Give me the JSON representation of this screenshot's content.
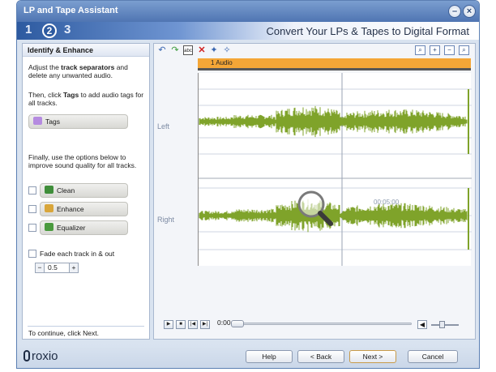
{
  "window": {
    "title": "LP and Tape Assistant"
  },
  "steps": {
    "items": [
      "1",
      "2",
      "3"
    ],
    "active": "2",
    "heading": "Convert Your LPs & Tapes to Digital Format"
  },
  "sidebar": {
    "title": "Identify & Enhance",
    "intro_prefix": "Adjust the ",
    "intro_bold": "track separators",
    "intro_suffix": " and delete any unwanted audio.",
    "tags_prefix": "Then, click ",
    "tags_bold": "Tags",
    "tags_suffix": " to add audio tags for all tracks.",
    "tags_button": "Tags",
    "options_text": "Finally, use the options below to improve sound quality for all tracks.",
    "clean_label": "Clean",
    "enhance_label": "Enhance",
    "equalizer_label": "Equalizer",
    "fade_label": "Fade each track in & out",
    "fade_value": "0.5",
    "footer_text": "To continue, click Next."
  },
  "editor": {
    "track_label": "1 Audio",
    "left_channel": "Left",
    "right_channel": "Right",
    "timecode": "00:05:00",
    "position": "0:00",
    "tools": [
      "undo-icon",
      "redo-icon",
      "rename-icon",
      "delete-icon",
      "split-icon",
      "join-icon"
    ],
    "zoom_tools": [
      "zoom-fit-icon",
      "zoom-in-icon",
      "zoom-out-icon",
      "zoom-selection-icon"
    ]
  },
  "footer": {
    "logo": "roxio",
    "help": "Help",
    "back": "< Back",
    "next": "Next >",
    "cancel": "Cancel"
  },
  "colors": {
    "track_header": "#f4a637",
    "waveform": "#7fa32a",
    "accent": "#4f75b2"
  }
}
